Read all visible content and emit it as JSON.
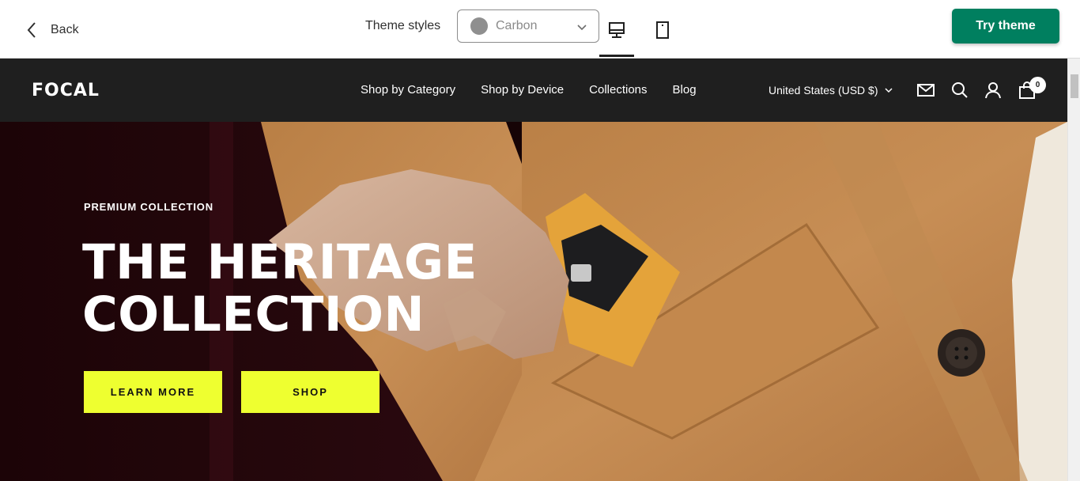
{
  "topbar": {
    "back_label": "Back",
    "styles_label": "Theme styles",
    "style_select": {
      "value": "Carbon",
      "swatch_color": "#8f8f8f"
    },
    "devices": [
      "desktop-icon",
      "mobile-icon"
    ],
    "active_device": "desktop",
    "try_button": "Try theme",
    "try_button_color": "#007f5f"
  },
  "store": {
    "logo": "FOCAL",
    "nav": [
      "Shop by Category",
      "Shop by Device",
      "Collections",
      "Blog"
    ],
    "currency": "United States (USD $)",
    "icons": [
      "mail-icon",
      "search-icon",
      "account-icon",
      "cart-icon"
    ],
    "cart_count": "0",
    "header_color": "#1f1f1f"
  },
  "hero": {
    "eyebrow": "PREMIUM COLLECTION",
    "headline_line1": "THE HERITAGE",
    "headline_line2": "COLLECTION",
    "buttons": [
      "LEARN MORE",
      "SHOP"
    ],
    "button_color": "#eeff30"
  }
}
